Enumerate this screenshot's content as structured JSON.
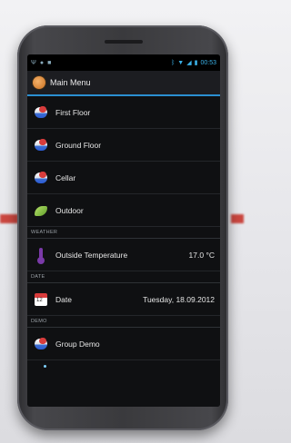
{
  "statusbar": {
    "time": "00:53",
    "left_icons": [
      "usb-icon",
      "android-icon",
      "chat-icon"
    ],
    "right_icons": [
      "bluetooth-icon",
      "wifi-icon",
      "signal-icon",
      "battery-icon"
    ]
  },
  "actionbar": {
    "title": "Main Menu"
  },
  "menu": {
    "items": [
      {
        "label": "First Floor",
        "icon": "house-icon"
      },
      {
        "label": "Ground Floor",
        "icon": "house-icon"
      },
      {
        "label": "Cellar",
        "icon": "house-icon"
      },
      {
        "label": "Outdoor",
        "icon": "leaf-icon"
      }
    ],
    "weather_section": "WEATHER",
    "weather_item": {
      "label": "Outside Temperature",
      "value": "17.0 °C",
      "icon": "thermometer-icon"
    },
    "date_section": "DATE",
    "date_item": {
      "label": "Date",
      "value": "Tuesday, 18.09.2012",
      "icon": "calendar-icon"
    },
    "demo_section": "DEMO",
    "demo_item": {
      "label": "Group Demo",
      "icon": "house-icon"
    }
  },
  "colors": {
    "accent": "#2b8fd1",
    "background": "#0f1012",
    "text": "#e6e6e6"
  }
}
